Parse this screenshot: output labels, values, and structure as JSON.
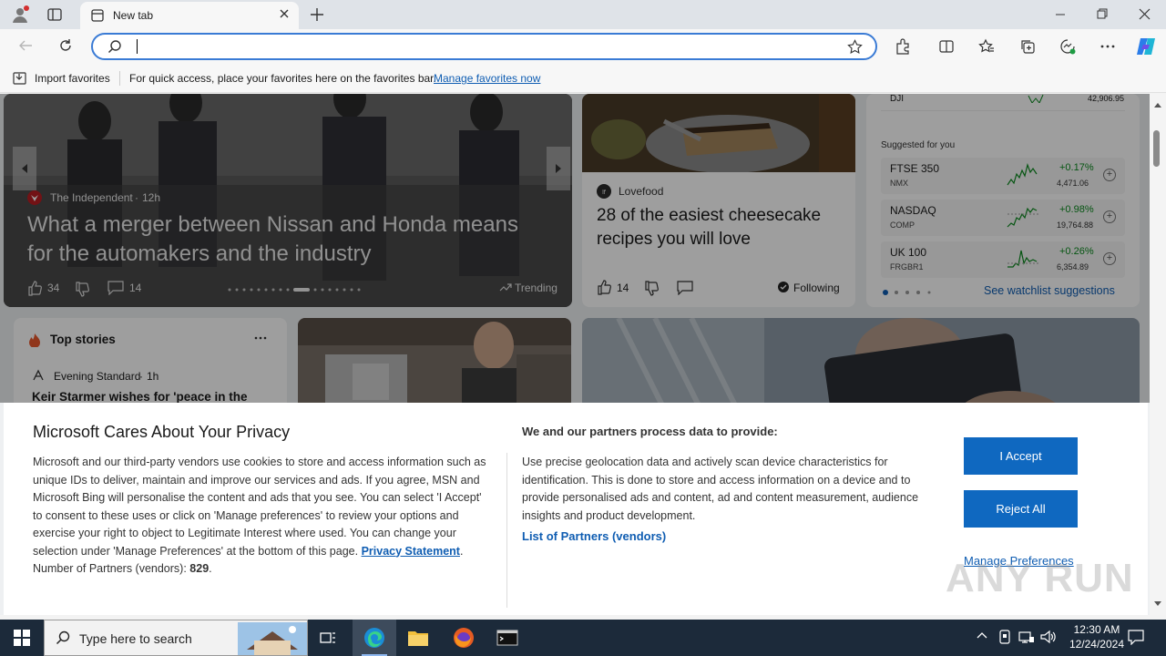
{
  "browser": {
    "tab_title": "New tab",
    "address_value": "",
    "favorites_bar": {
      "import_label": "Import favorites",
      "hint": "For quick access, place your favorites here on the favorites bar.",
      "manage_link": "Manage favorites now"
    }
  },
  "hero": {
    "source": "The Independent",
    "age": "12h",
    "headline": "What a merger between Nissan and Honda means for the automakers and the industry",
    "likes": "34",
    "comments": "14",
    "trending_label": "Trending"
  },
  "food_card": {
    "source": "Lovefood",
    "headline": "28 of the easiest cheesecake recipes you will love",
    "likes": "14",
    "following_label": "Following"
  },
  "markets": {
    "top_row": {
      "name": "DJI",
      "value": "42,906.95"
    },
    "suggested_label": "Suggested for you",
    "rows": [
      {
        "name": "FTSE 350",
        "exchange": "NMX",
        "change": "+0.17%",
        "value": "4,471.06"
      },
      {
        "name": "NASDAQ",
        "exchange": "COMP",
        "change": "+0.98%",
        "value": "19,764.88"
      },
      {
        "name": "UK 100",
        "exchange": "FRGBR1",
        "change": "+0.26%",
        "value": "6,354.89"
      }
    ],
    "watchlist_link": "See watchlist suggestions"
  },
  "top_stories": {
    "title": "Top stories",
    "source": "Evening Standard",
    "age": "1h",
    "headline": "Keir Starmer wishes for 'peace in the"
  },
  "privacy": {
    "title": "Microsoft Cares About Your Privacy",
    "body": "Microsoft and our third-party vendors use cookies to store and access information such as unique IDs to deliver, maintain and improve our services and ads. If you agree, MSN and Microsoft Bing will personalise the content and ads that you see. You can select 'I Accept' to consent to these uses or click on 'Manage preferences' to review your options and exercise your right to object to Legitimate Interest where used.  You can change your selection under 'Manage Preferences' at the bottom of this page.",
    "privacy_link": "Privacy Statement",
    "partners_count_label": "Number of Partners (vendors):",
    "partners_count": "829",
    "right_title": "We and our partners process data to provide:",
    "right_body": "Use precise geolocation data and actively scan device characteristics for identification. This is done to store and access information on a device and to provide personalised ads and content, ad and content measurement, audience insights and product development.",
    "partners_link": "List of Partners (vendors)",
    "accept_label": "I Accept",
    "reject_label": "Reject All",
    "manage_label": "Manage Preferences"
  },
  "taskbar": {
    "search_placeholder": "Type here to search",
    "time": "12:30 AM",
    "date": "12/24/2024"
  },
  "watermark": "ANY RUN",
  "colors": {
    "accent": "#0f68c0",
    "link": "#0f5db2",
    "positive": "#0a8a1e"
  }
}
